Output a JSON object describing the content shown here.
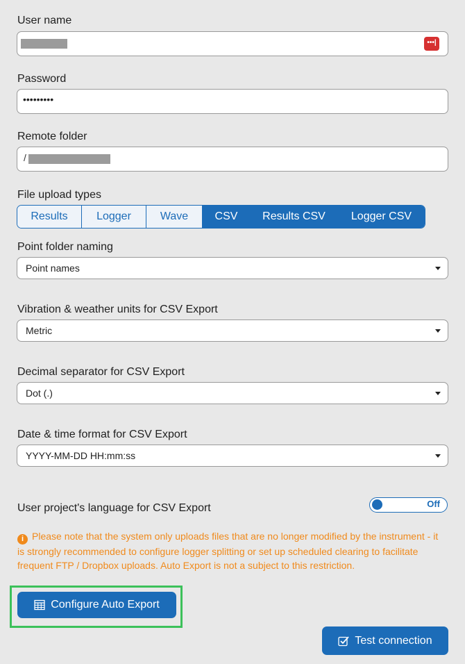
{
  "username": {
    "label": "User name",
    "keypass_icon": "password-manager-icon",
    "keypass_text": "•••|"
  },
  "password": {
    "label": "Password",
    "value": "•••••••••"
  },
  "remote_folder": {
    "label": "Remote folder",
    "prefix": "/"
  },
  "file_upload_types": {
    "label": "File upload types",
    "options": [
      {
        "label": "Results",
        "selected": false
      },
      {
        "label": "Logger",
        "selected": false
      },
      {
        "label": "Wave",
        "selected": false
      },
      {
        "label": "CSV",
        "selected": true
      },
      {
        "label": "Results CSV",
        "selected": true
      },
      {
        "label": "Logger CSV",
        "selected": true
      }
    ]
  },
  "point_folder_naming": {
    "label": "Point folder naming",
    "value": "Point names"
  },
  "units": {
    "label": "Vibration & weather units for CSV Export",
    "value": "Metric"
  },
  "decimal_separator": {
    "label": "Decimal separator for CSV Export",
    "value": "Dot (.)"
  },
  "date_format": {
    "label": "Date & time format for CSV Export",
    "value": "YYYY-MM-DD HH:mm:ss"
  },
  "language": {
    "label": "User project's language for CSV Export",
    "toggle_state": "Off"
  },
  "note": {
    "icon": "info-icon",
    "text": "Please note that the system only uploads files that are no longer modified by the instrument - it is strongly recommended to configure logger splitting or set up scheduled clearing to facilitate frequent FTP / Dropbox uploads. Auto Export is not a subject to this restriction."
  },
  "buttons": {
    "configure_auto_export": "Configure Auto Export",
    "test_connection": "Test connection"
  },
  "colors": {
    "primary": "#1c6cb8",
    "warning": "#f08a1c",
    "highlight": "#3cc15a",
    "background": "#e8e8e8"
  }
}
